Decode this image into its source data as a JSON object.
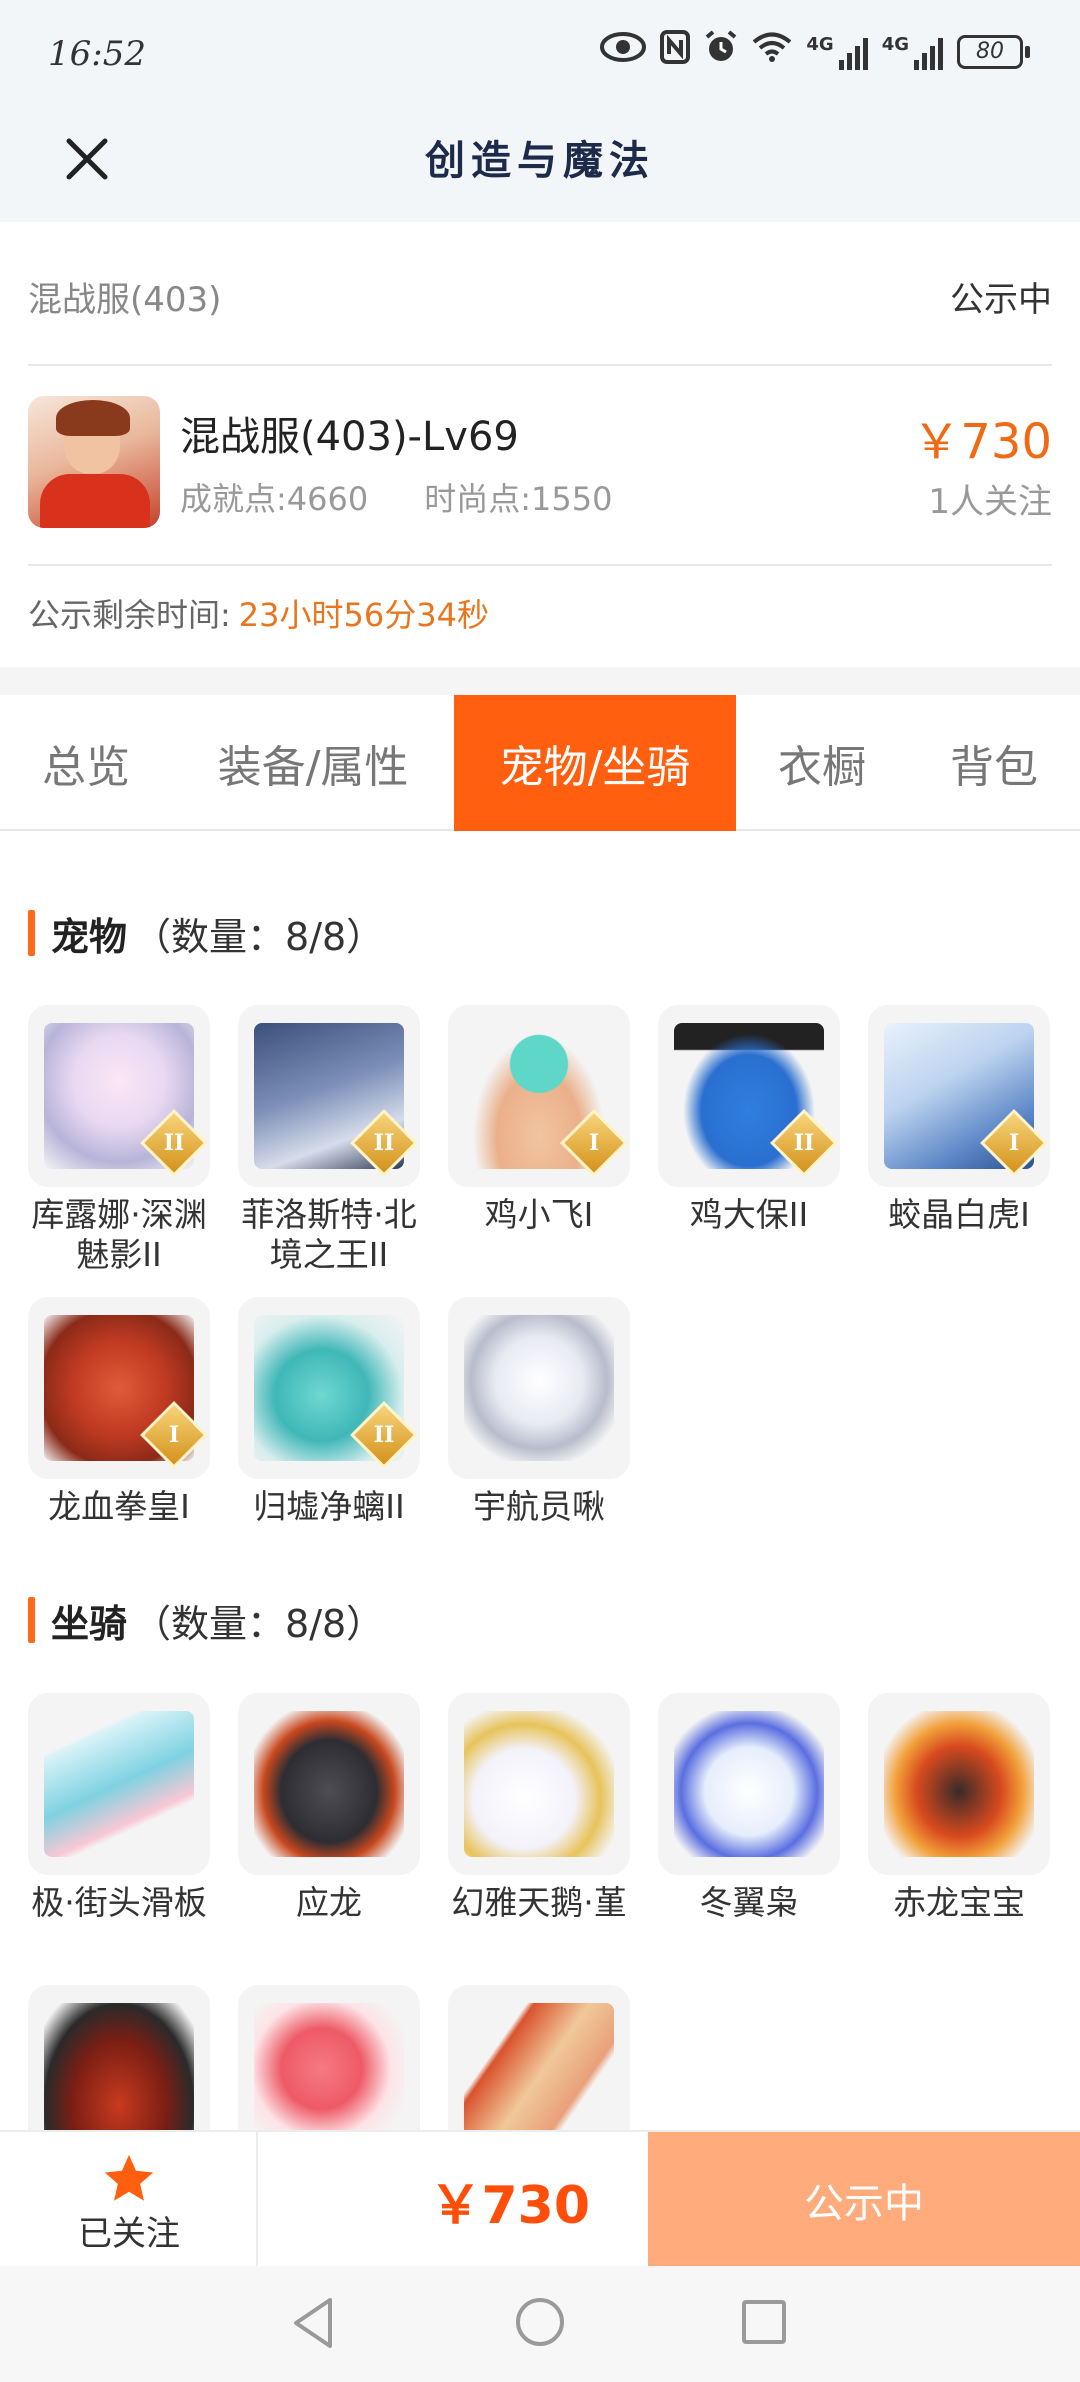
{
  "status_bar": {
    "time": "16:52",
    "battery": "80",
    "net1": "4G",
    "net2": "4G"
  },
  "header": {
    "title": "创造与魔法"
  },
  "server": {
    "name": "混战服(403)",
    "status": "公示中"
  },
  "character": {
    "name": "混战服(403)-Lv69",
    "achievement": "成就点:4660",
    "fashion": "时尚点:1550",
    "price": "￥730",
    "followers": "1人关注"
  },
  "countdown": {
    "label": "公示剩余时间:",
    "value": "23小时56分34秒"
  },
  "tabs": [
    {
      "label": "总览"
    },
    {
      "label": "装备/属性"
    },
    {
      "label": "宠物/坐骑"
    },
    {
      "label": "衣橱"
    },
    {
      "label": "背包"
    }
  ],
  "active_tab": "宠物/坐骑",
  "pets": {
    "title": "宠物",
    "count": "（数量：8/8）",
    "items": [
      {
        "name": "库露娜·深渊魅影II",
        "tier": "II"
      },
      {
        "name": "菲洛斯特·北境之王II",
        "tier": "II"
      },
      {
        "name": "鸡小飞I",
        "tier": "I"
      },
      {
        "name": "鸡大保II",
        "tier": "II"
      },
      {
        "name": "蛟晶白虎Ⅰ",
        "tier": "I"
      },
      {
        "name": "龙血拳皇Ⅰ",
        "tier": "I"
      },
      {
        "name": "归墟净螭II",
        "tier": "II"
      },
      {
        "name": "宇航员啾",
        "tier": ""
      }
    ]
  },
  "mounts": {
    "title": "坐骑",
    "count": "（数量：8/8）",
    "items": [
      {
        "name": "极·街头滑板"
      },
      {
        "name": "应龙"
      },
      {
        "name": "幻雅天鹅·堇"
      },
      {
        "name": "冬翼枭"
      },
      {
        "name": "赤龙宝宝"
      },
      {
        "name": ""
      },
      {
        "name": ""
      },
      {
        "name": ""
      }
    ]
  },
  "bottom_bar": {
    "follow_label": "已关注",
    "price": "￥730",
    "status_button": "公示中"
  },
  "colors": {
    "accent": "#ff5f0f",
    "price": "#f06a14",
    "status_button": "#ffab7c"
  }
}
